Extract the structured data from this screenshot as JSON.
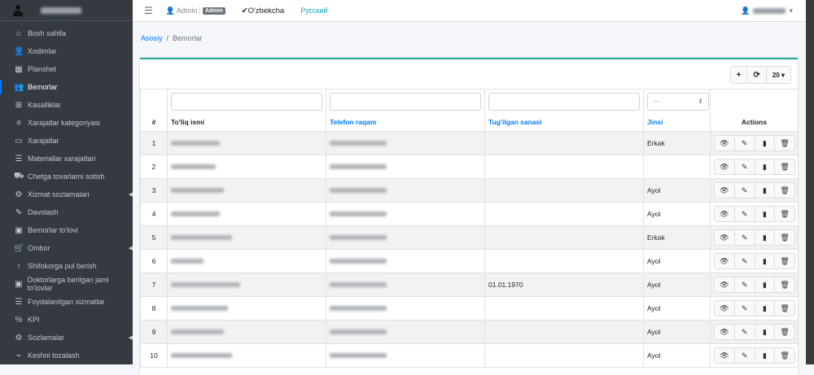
{
  "sidebar": {
    "items": [
      {
        "label": "Bosh sahifa",
        "icon": "home-icon"
      },
      {
        "label": "Xodimlar",
        "icon": "user-tie-icon"
      },
      {
        "label": "Planshet",
        "icon": "calendar-icon"
      },
      {
        "label": "Bemorlar",
        "icon": "users-icon",
        "active": true
      },
      {
        "label": "Kasalliklar",
        "icon": "medical-file-icon"
      },
      {
        "label": "Xarajatlar kategoriyasi",
        "icon": "bars-icon"
      },
      {
        "label": "Xarajatlar",
        "icon": "money-check-icon"
      },
      {
        "label": "Materiallar xarajatlari",
        "icon": "list-icon"
      },
      {
        "label": "Chetga tovarlarni sotish",
        "icon": "truck-icon"
      },
      {
        "label": "Xizmat sozlamalari",
        "icon": "cogs-icon",
        "submenu": true
      },
      {
        "label": "Davolash",
        "icon": "syringe-icon"
      },
      {
        "label": "Bemorlar to'lovi",
        "icon": "money-bill-icon"
      },
      {
        "label": "Ombor",
        "icon": "cart-icon",
        "submenu": true
      },
      {
        "label": "Shifokorga pul berish",
        "icon": "arrow-up-icon"
      },
      {
        "label": "Doktorlarga berilgan jami to'lovlar",
        "icon": "money-bill-icon"
      },
      {
        "label": "Foydalanilgan xizmatlar",
        "icon": "list-icon"
      },
      {
        "label": "KPI",
        "icon": "percent-icon"
      },
      {
        "label": "Sozlamalar",
        "icon": "cogs-icon",
        "submenu": true
      },
      {
        "label": "Keshni tozalash",
        "icon": "broom-icon"
      }
    ]
  },
  "topbar": {
    "user": "Admin",
    "role": "Admin",
    "lang_uz": "O'zbekcha",
    "lang_ru": "Русский"
  },
  "breadcrumb": {
    "home": "Asosiy",
    "current": "Bemorlar"
  },
  "toolbar": {
    "page_size": "20"
  },
  "table": {
    "filter_select": "---",
    "headers": {
      "num": "#",
      "name": "To'liq ismi",
      "phone": "Telefon raqam",
      "birth": "Tug'ilgan sanasi",
      "gender": "Jinsi",
      "actions": "Actions"
    },
    "rows": [
      {
        "n": "1",
        "birth": "",
        "gender": "Erkak"
      },
      {
        "n": "2",
        "birth": "",
        "gender": ""
      },
      {
        "n": "3",
        "birth": "",
        "gender": "Ayol"
      },
      {
        "n": "4",
        "birth": "",
        "gender": "Ayol"
      },
      {
        "n": "5",
        "birth": "",
        "gender": "Erkak"
      },
      {
        "n": "6",
        "birth": "",
        "gender": "Ayol"
      },
      {
        "n": "7",
        "birth": "01.01.1970",
        "gender": "Ayol"
      },
      {
        "n": "8",
        "birth": "",
        "gender": "Ayol"
      },
      {
        "n": "9",
        "birth": "",
        "gender": "Ayol"
      },
      {
        "n": "10",
        "birth": "",
        "gender": "Ayol"
      }
    ]
  },
  "colors": {
    "sidebar": "#343a40",
    "accent": "#007bff",
    "card_border": "#20a7a0"
  }
}
